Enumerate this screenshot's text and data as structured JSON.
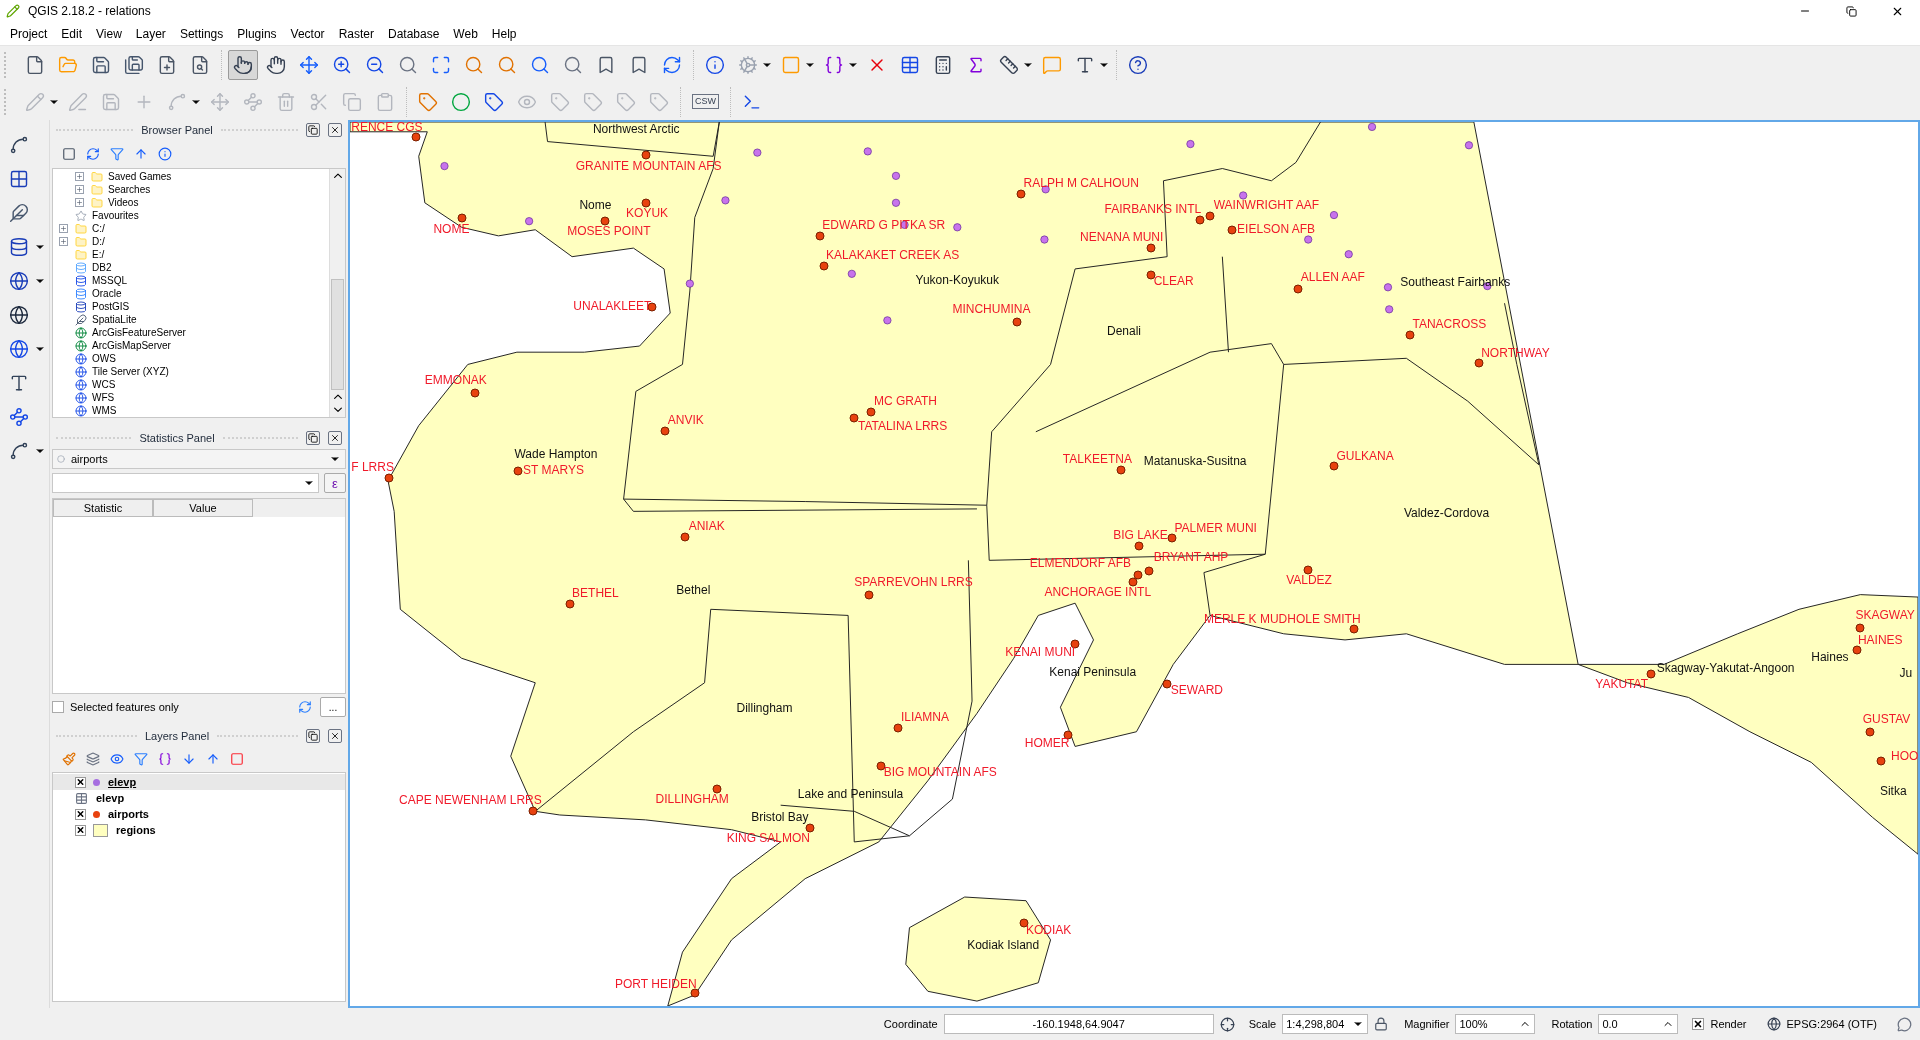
{
  "window": {
    "title": "QGIS 2.18.2 - relations"
  },
  "menu": [
    "Project",
    "Edit",
    "View",
    "Layer",
    "Settings",
    "Plugins",
    "Vector",
    "Raster",
    "Database",
    "Web",
    "Help"
  ],
  "toolbars": [
    {
      "groups": [
        {
          "buttons": [
            {
              "kind": "new",
              "selected": false
            },
            {
              "kind": "open",
              "selected": false
            },
            {
              "kind": "save",
              "selected": false
            },
            {
              "kind": "save_as",
              "selected": false
            },
            {
              "kind": "composer",
              "selected": false
            },
            {
              "kind": "composer_manager",
              "selected": false
            }
          ]
        },
        {
          "buttons": [
            {
              "kind": "touch",
              "selected": true
            },
            {
              "kind": "pan",
              "selected": false
            },
            {
              "kind": "pan_selection",
              "selected": false
            },
            {
              "kind": "zoom_in",
              "selected": false
            },
            {
              "kind": "zoom_out",
              "selected": false
            },
            {
              "kind": "zoom_native",
              "selected": false
            },
            {
              "kind": "zoom_full",
              "selected": false
            },
            {
              "kind": "zoom_layer",
              "selected": false
            },
            {
              "kind": "zoom_selection",
              "selected": false
            },
            {
              "kind": "zoom_last",
              "selected": false
            },
            {
              "kind": "zoom_next",
              "selected": false
            },
            {
              "kind": "bookmark_new",
              "selected": false
            },
            {
              "kind": "bookmarks",
              "selected": false
            },
            {
              "kind": "refresh",
              "selected": false
            }
          ]
        },
        {
          "buttons": [
            {
              "kind": "identify",
              "selected": false
            },
            {
              "kind": "action",
              "selected": false,
              "menu": true
            },
            {
              "kind": "select",
              "selected": false,
              "menu": true
            },
            {
              "kind": "select_expr",
              "selected": false,
              "menu": true
            },
            {
              "kind": "deselect",
              "selected": false
            },
            {
              "kind": "attribute_table",
              "selected": false
            },
            {
              "kind": "field_calc",
              "selected": false
            },
            {
              "kind": "statistics",
              "selected": false
            },
            {
              "kind": "measure",
              "selected": false,
              "menu": true
            },
            {
              "kind": "map_tips",
              "selected": false
            },
            {
              "kind": "annotation",
              "selected": false,
              "menu": true
            }
          ]
        },
        {
          "buttons": [
            {
              "kind": "help",
              "selected": false
            }
          ]
        }
      ]
    },
    {
      "groups": [
        {
          "buttons": [
            {
              "kind": "toggle_edit",
              "disabled": true,
              "menu": true
            },
            {
              "kind": "current_edits",
              "disabled": true
            },
            {
              "kind": "save_edits",
              "disabled": true
            },
            {
              "kind": "add_feature",
              "disabled": true
            },
            {
              "kind": "node",
              "disabled": true,
              "menu": true
            },
            {
              "kind": "move_feature",
              "disabled": true
            },
            {
              "kind": "node_tool",
              "disabled": true
            },
            {
              "kind": "delete",
              "disabled": true
            },
            {
              "kind": "cut",
              "disabled": true
            },
            {
              "kind": "copy",
              "disabled": true
            },
            {
              "kind": "paste",
              "disabled": true
            }
          ]
        },
        {
          "buttons": [
            {
              "kind": "label",
              "disabled": false
            },
            {
              "kind": "diagram",
              "disabled": false
            },
            {
              "kind": "pin",
              "disabled": false
            },
            {
              "kind": "show_hide",
              "disabled": true
            },
            {
              "kind": "move_label",
              "disabled": true
            },
            {
              "kind": "rotate_label",
              "disabled": true
            },
            {
              "kind": "change_label",
              "disabled": true
            },
            {
              "kind": "label_tool",
              "disabled": true
            }
          ]
        },
        {
          "buttons": [
            {
              "kind": "csw",
              "disabled": false,
              "label": "CSW"
            }
          ]
        },
        {
          "buttons": [
            {
              "kind": "python",
              "disabled": false
            }
          ]
        }
      ]
    }
  ],
  "side_toolbar": [
    {
      "kind": "add_vector"
    },
    {
      "kind": "add_raster"
    },
    {
      "kind": "add_spatialite"
    },
    {
      "kind": "add_postgis",
      "menu": true
    },
    {
      "kind": "add_wms",
      "menu": true
    },
    {
      "kind": "add_wcs"
    },
    {
      "kind": "add_wfs",
      "menu": true
    },
    {
      "kind": "add_text"
    },
    {
      "kind": "add_virtual"
    },
    {
      "kind": "new_layer",
      "menu": true
    }
  ],
  "browser_panel": {
    "title": "Browser Panel",
    "items": [
      {
        "children": [
          {
            "label": "Saved Games",
            "kind": "folder",
            "expanded": false
          },
          {
            "label": "Searches",
            "kind": "folder",
            "expanded": false
          },
          {
            "label": "Videos",
            "kind": "folder",
            "expanded": false
          }
        ]
      },
      {
        "label": "Favourites",
        "kind": "star"
      },
      {
        "label": "C:/",
        "kind": "folder",
        "expanded": false
      },
      {
        "label": "D:/",
        "kind": "folder",
        "expanded": false
      },
      {
        "label": "E:/",
        "kind": "folder"
      },
      {
        "label": "DB2",
        "kind": "db2"
      },
      {
        "label": "MSSQL",
        "kind": "mssql"
      },
      {
        "label": "Oracle",
        "kind": "oracle"
      },
      {
        "label": "PostGIS",
        "kind": "postgis"
      },
      {
        "label": "SpatiaLite",
        "kind": "spatialite"
      },
      {
        "label": "ArcGisFeatureServer",
        "kind": "arcgis"
      },
      {
        "label": "ArcGisMapServer",
        "kind": "arcgis"
      },
      {
        "label": "OWS",
        "kind": "globe"
      },
      {
        "label": "Tile Server (XYZ)",
        "kind": "globe"
      },
      {
        "label": "WCS",
        "kind": "globe"
      },
      {
        "label": "WFS",
        "kind": "globe"
      },
      {
        "label": "WMS",
        "kind": "globe"
      }
    ]
  },
  "statistics_panel": {
    "title": "Statistics Panel",
    "layer": "airports",
    "expression_button": "ε",
    "columns": [
      "Statistic",
      "Value"
    ],
    "selected_only": {
      "label": "Selected features only",
      "checked": false
    },
    "more_button": "..."
  },
  "layers_panel": {
    "title": "Layers Panel",
    "layers": [
      {
        "name": "elevp",
        "kind": "point",
        "color": "#a66ee0",
        "checked": true,
        "selected": true
      },
      {
        "name": "elevp",
        "kind": "table",
        "selected": false
      },
      {
        "name": "airports",
        "kind": "point",
        "color": "#e8420f",
        "checked": true,
        "selected": false
      },
      {
        "name": "regions",
        "kind": "polygon",
        "color": "#ffffc0",
        "checked": true,
        "selected": false
      }
    ]
  },
  "map": {
    "labels": [
      {
        "kind": "airport",
        "text": "RENCE CGS"
      },
      {
        "kind": "airport",
        "text": "GRANITE MOUNTAIN AFS"
      },
      {
        "kind": "airport",
        "text": "KOYUK"
      },
      {
        "kind": "airport",
        "text": "NOME"
      },
      {
        "kind": "airport",
        "text": "MOSES POINT"
      },
      {
        "kind": "airport",
        "text": "UNALAKLEET"
      },
      {
        "kind": "airport",
        "text": "EMMONAK"
      },
      {
        "kind": "airport",
        "text": "ANVIK"
      },
      {
        "kind": "airport",
        "text": "F LRRS"
      },
      {
        "kind": "airport",
        "text": "ST MARYS"
      },
      {
        "kind": "airport",
        "text": "ANIAK"
      },
      {
        "kind": "airport",
        "text": "BETHEL"
      },
      {
        "kind": "airport",
        "text": "EDWARD G PITKA SR"
      },
      {
        "kind": "airport",
        "text": "KALAKAKET CREEK  AS"
      },
      {
        "kind": "airport",
        "text": "RALPH M CALHOUN"
      },
      {
        "kind": "airport",
        "text": "FAIRBANKS INTL"
      },
      {
        "kind": "airport",
        "text": "WAINWRIGHT AAF"
      },
      {
        "kind": "airport",
        "text": "EIELSON AFB"
      },
      {
        "kind": "airport",
        "text": "NENANA MUNI"
      },
      {
        "kind": "airport",
        "text": "CLEAR"
      },
      {
        "kind": "airport",
        "text": "MINCHUMINA"
      },
      {
        "kind": "airport",
        "text": "ALLEN AAF"
      },
      {
        "kind": "airport",
        "text": "TANACROSS"
      },
      {
        "kind": "airport",
        "text": "NORTHWAY"
      },
      {
        "kind": "airport",
        "text": "MC GRATH"
      },
      {
        "kind": "airport",
        "text": "TATALINA LRRS"
      },
      {
        "kind": "airport",
        "text": "TALKEETNA"
      },
      {
        "kind": "airport",
        "text": "GULKANA"
      },
      {
        "kind": "airport",
        "text": "BIG LAKE"
      },
      {
        "kind": "airport",
        "text": "PALMER MUNI"
      },
      {
        "kind": "airport",
        "text": "ELMENDORF AFB"
      },
      {
        "kind": "airport",
        "text": "BRYANT AHP"
      },
      {
        "kind": "airport",
        "text": "ANCHORAGE INTL"
      },
      {
        "kind": "airport",
        "text": "VALDEZ"
      },
      {
        "kind": "airport",
        "text": "SPARREVOHN LRRS"
      },
      {
        "kind": "airport",
        "text": "MERLE K MUDHOLE SMITH"
      },
      {
        "kind": "airport",
        "text": "KENAI MUNI"
      },
      {
        "kind": "airport",
        "text": "SEWARD"
      },
      {
        "kind": "airport",
        "text": "ILIAMNA"
      },
      {
        "kind": "airport",
        "text": "HOMER"
      },
      {
        "kind": "airport",
        "text": "BIG MOUNTAIN AFS"
      },
      {
        "kind": "airport",
        "text": "CAPE NEWENHAM LRRS"
      },
      {
        "kind": "airport",
        "text": "DILLINGHAM"
      },
      {
        "kind": "airport",
        "text": "KING SALMON"
      },
      {
        "kind": "airport",
        "text": "KODIAK"
      },
      {
        "kind": "airport",
        "text": "PORT HEIDEN"
      },
      {
        "kind": "airport",
        "text": "YAKUTAT"
      },
      {
        "kind": "airport",
        "text": "SKAGWAY"
      },
      {
        "kind": "airport",
        "text": "HAINES"
      },
      {
        "kind": "airport",
        "text": "GUSTAV"
      },
      {
        "kind": "airport",
        "text": "HOO"
      },
      {
        "kind": "region",
        "text": "Northwest Arctic"
      },
      {
        "kind": "region",
        "text": "Nome"
      },
      {
        "kind": "region",
        "text": "Yukon-Koyukuk"
      },
      {
        "kind": "region",
        "text": "Southeast Fairbanks"
      },
      {
        "kind": "region",
        "text": "Denali"
      },
      {
        "kind": "region",
        "text": "Wade Hampton"
      },
      {
        "kind": "region",
        "text": "Matanuska-Susitna"
      },
      {
        "kind": "region",
        "text": "Valdez-Cordova"
      },
      {
        "kind": "region",
        "text": "Bethel"
      },
      {
        "kind": "region",
        "text": "Kenai Peninsula"
      },
      {
        "kind": "region",
        "text": "Skagway-Yakutat-Angoon"
      },
      {
        "kind": "region",
        "text": "Haines"
      },
      {
        "kind": "region",
        "text": "Ju"
      },
      {
        "kind": "region",
        "text": "Dillingham"
      },
      {
        "kind": "region",
        "text": "Lake and Peninsula"
      },
      {
        "kind": "region",
        "text": "Bristol Bay"
      },
      {
        "kind": "region",
        "text": "Kodiak Island"
      },
      {
        "kind": "region",
        "text": "Sitka"
      }
    ]
  },
  "status_bar": {
    "coordinate_label": "Coordinate",
    "coordinate": "-160.1948,64.9047",
    "scale_label": "Scale",
    "scale": "1:4,298,804",
    "magnifier_label": "Magnifier",
    "magnifier": "100%",
    "rotation_label": "Rotation",
    "rotation": "0.0",
    "render": {
      "label": "Render",
      "checked": true
    },
    "crs": "EPSG:2964 (OTF)"
  }
}
